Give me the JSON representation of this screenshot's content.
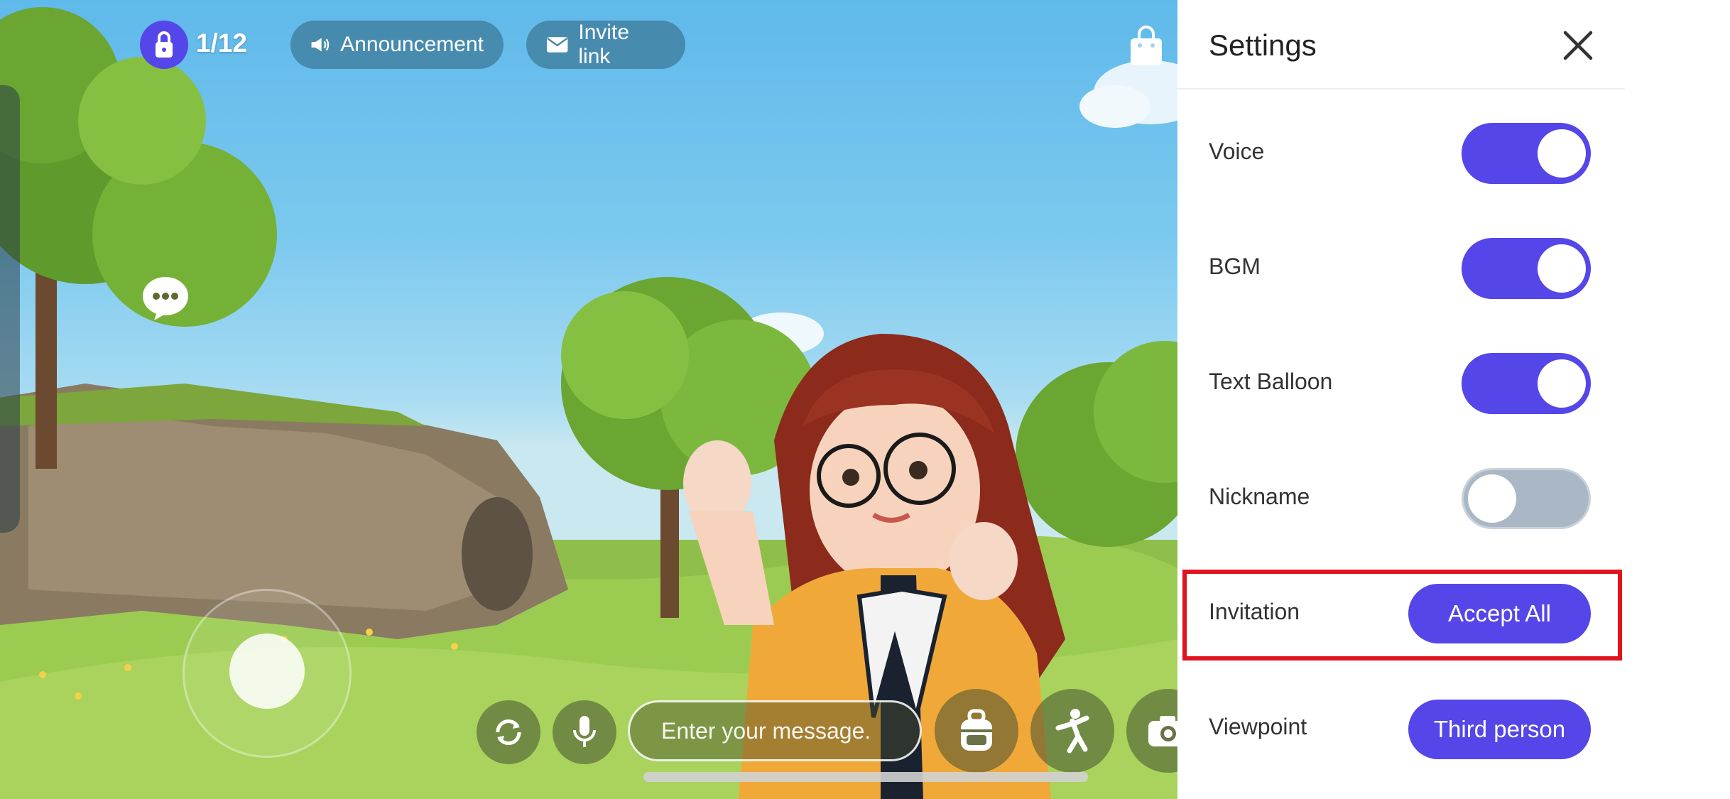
{
  "hud": {
    "room_count": "1/12",
    "announcement_label": "Announcement",
    "invite_label": "Invite link"
  },
  "bottom_bar": {
    "message_placeholder": "Enter your message."
  },
  "settings": {
    "title": "Settings",
    "rows": [
      {
        "label": "Voice",
        "control": "toggle",
        "state": "on"
      },
      {
        "label": "BGM",
        "control": "toggle",
        "state": "on"
      },
      {
        "label": "Text Balloon",
        "control": "toggle",
        "state": "on"
      },
      {
        "label": "Nickname",
        "control": "toggle",
        "state": "off"
      },
      {
        "label": "Invitation",
        "control": "button",
        "value": "Accept All"
      },
      {
        "label": "Viewpoint",
        "control": "button",
        "value": "Third person"
      }
    ]
  },
  "icons": {
    "lock": "lock-icon",
    "announcement": "megaphone-icon",
    "invite": "envelope-icon",
    "shop": "shopping-bag-icon",
    "chat": "speech-bubble-icon",
    "rotate": "rotate-camera-icon",
    "mic": "microphone-icon",
    "backpack": "backpack-icon",
    "gesture": "dance-icon",
    "camera": "camera-icon",
    "close": "close-icon"
  },
  "colors": {
    "accent": "#5446e8",
    "highlight": "#e0141e",
    "toggle_off": "#aab7c4"
  }
}
